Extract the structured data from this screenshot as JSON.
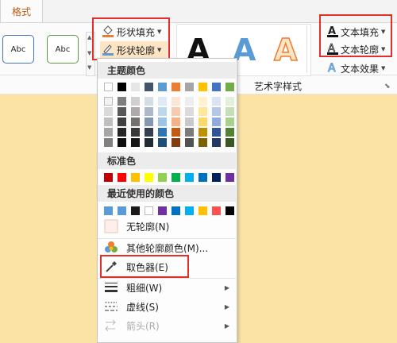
{
  "tabs": {
    "format": "格式"
  },
  "ribbon": {
    "style_samples": [
      "Abc",
      "Abc"
    ],
    "shape_fill": "形状填充",
    "shape_outline": "形状轮廓",
    "wordart_letter": "A",
    "wordart_group_label": "艺术字样式",
    "text_fill": "文本填充",
    "text_outline": "文本轮廓",
    "text_effect": "文本效果"
  },
  "menu": {
    "theme_colors_header": "主题颜色",
    "standard_colors_header": "标准色",
    "recent_colors_header": "最近使用的颜色",
    "items": {
      "no_outline": "无轮廓(N)",
      "more_colors": "其他轮廓颜色(M)...",
      "eyedropper": "取色器(E)",
      "weight": "粗细(W)",
      "dashes": "虚线(S)",
      "arrows": "箭头(R)"
    },
    "theme_top_row": [
      "#ffffff",
      "#000000",
      "#e7e6e6",
      "#44546a",
      "#5b9bd5",
      "#ed7d31",
      "#a5a5a5",
      "#ffc000",
      "#4472c4",
      "#70ad47"
    ],
    "theme_columns": [
      [
        "#f2f2f2",
        "#d9d9d9",
        "#bfbfbf",
        "#a6a6a6",
        "#808080"
      ],
      [
        "#7f7f7f",
        "#595959",
        "#404040",
        "#262626",
        "#0d0d0d"
      ],
      [
        "#d0cece",
        "#aeaaaa",
        "#757171",
        "#3a3838",
        "#171616"
      ],
      [
        "#d6dce4",
        "#adb9ca",
        "#8496b0",
        "#333f4f",
        "#222a35"
      ],
      [
        "#deebf7",
        "#bdd7ee",
        "#9dc3e6",
        "#2e75b6",
        "#1f4e79"
      ],
      [
        "#fbe5d6",
        "#f8cbad",
        "#f4b183",
        "#c55a11",
        "#843c0c"
      ],
      [
        "#ededed",
        "#dbdbdb",
        "#c9c9c9",
        "#7b7b7b",
        "#525252"
      ],
      [
        "#fff2cc",
        "#ffe699",
        "#ffd966",
        "#bf9000",
        "#7f6000"
      ],
      [
        "#dae3f3",
        "#b4c7e7",
        "#8faadc",
        "#2f5597",
        "#203864"
      ],
      [
        "#e2f0d9",
        "#c5e0b4",
        "#a9d18e",
        "#548235",
        "#385723"
      ]
    ],
    "standard_row": [
      "#c00000",
      "#ff0000",
      "#ffc000",
      "#ffff00",
      "#92d050",
      "#00b050",
      "#00b0f0",
      "#0070c0",
      "#002060",
      "#7030a0"
    ],
    "recent_row": [
      "#5b9bd5",
      "#5b9bd5",
      "#1a1a1a",
      "#ffffff",
      "#7030a0",
      "#0070c0",
      "#00b0f0",
      "#ffc000",
      "#ff5050",
      "#000000"
    ]
  },
  "colors": {
    "accent_tab": "#c0590f",
    "highlight_box": "#e0302b",
    "wordart_blue": "#5b9bd5",
    "wordart_orange": "#ed7d31"
  },
  "icons": [
    "paint-bucket-icon",
    "pen-outline-icon",
    "text-fill-icon",
    "text-outline-icon",
    "text-effect-icon",
    "eyedropper-icon",
    "line-weight-icon",
    "dash-style-icon",
    "arrow-style-icon"
  ]
}
